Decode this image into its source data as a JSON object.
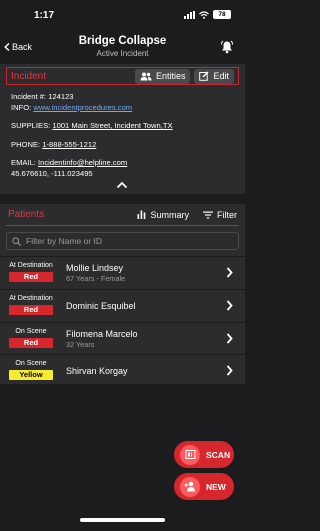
{
  "status_bar": {
    "time": "1:17",
    "battery": "78"
  },
  "nav": {
    "back_label": "Back",
    "title": "Bridge Collapse",
    "subtitle": "Active Incident"
  },
  "incident": {
    "section_label": "Incident",
    "entities_label": "Entities",
    "edit_label": "Edit",
    "number_label": "Incident #:",
    "number": "124123",
    "info_label": "INFO:",
    "info_link": "www.incidentprocedures.com",
    "supplies_label": "SUPPLIES:",
    "supplies_address": "1001 Main Street, Incident Town,TX",
    "phone_label": "PHONE:",
    "phone": "1-888-555-1212",
    "email_label": "EMAIL:",
    "email": "Incidentinfo@helpline.com",
    "coordinates": "45.676610, -111.023495"
  },
  "patients": {
    "section_label": "Patients",
    "summary_label": "Summary",
    "filter_label": "Filter",
    "search_placeholder": "Filter by Name or ID",
    "rows": [
      {
        "status": "At Destination",
        "triage": "Red",
        "name": "Mollie Lindsey",
        "detail": "67 Years - Female"
      },
      {
        "status": "At Destination",
        "triage": "Red",
        "name": "Dominic Esquibel",
        "detail": ""
      },
      {
        "status": "On Scene",
        "triage": "Red",
        "name": "Filomena Marcelo",
        "detail": "32 Years"
      },
      {
        "status": "On Scene",
        "triage": "Yellow",
        "name": "Shirvan Korgay",
        "detail": ""
      }
    ]
  },
  "actions": {
    "scan_label": "SCAN",
    "new_label": "NEW"
  },
  "colors": {
    "accent": "#d6272c",
    "background": "#1c1c1e",
    "card": "#2c2c2e",
    "link": "#6fa8f5",
    "yellow": "#f6ec2e"
  }
}
